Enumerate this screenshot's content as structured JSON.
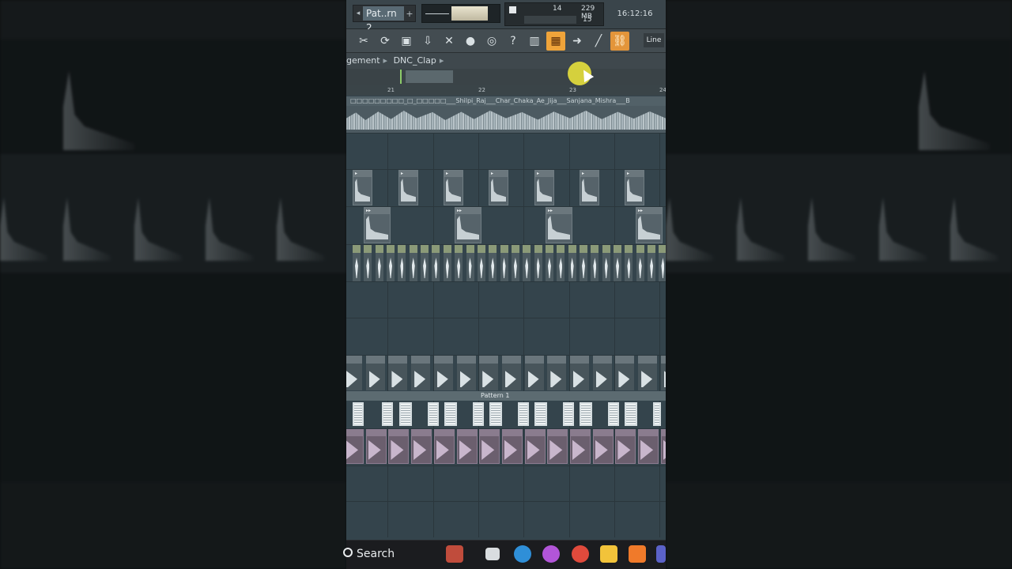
{
  "header": {
    "pattern_name": "Pat..rn 2",
    "pattern_prev": "◂",
    "pattern_add": "+",
    "cpu_value": "14",
    "memory": "229 MB",
    "polyphony": "15",
    "clock": "16:12:16"
  },
  "toolbar": {
    "icons": [
      "cut-tool-icon",
      "refresh-icon",
      "save-icon",
      "render-icon",
      "cut-icon",
      "microphone-icon",
      "chat-icon",
      "help-icon",
      "mixer-icon",
      "playlist-icon",
      "arrow-right-icon",
      "brush-icon",
      "link-icon"
    ],
    "snap_label": "Line"
  },
  "breadcrumb": {
    "items": [
      "gement",
      "DNC_Clap"
    ],
    "separator": "▸"
  },
  "ruler": {
    "bars": [
      "21",
      "22",
      "23",
      "24"
    ]
  },
  "clip_names": "□□□□□□□□□_□_□□□□□___Shilpi_Raj___Char_Chaka_Ae_Jija___Sanjana_Mishra___B",
  "pattern_label": "Pattern 1",
  "taskbar": {
    "search_label": "Search",
    "apps": [
      "widgets-icon",
      "task-view-icon",
      "edge-icon",
      "copilot-icon",
      "chrome-icon",
      "file-explorer-icon",
      "fl-studio-icon",
      "teams-icon"
    ]
  },
  "colors": {
    "playlist_bg": "#34444c",
    "toolbar_active": "#f0a43a",
    "cursor_highlight": "#e7e03c"
  }
}
